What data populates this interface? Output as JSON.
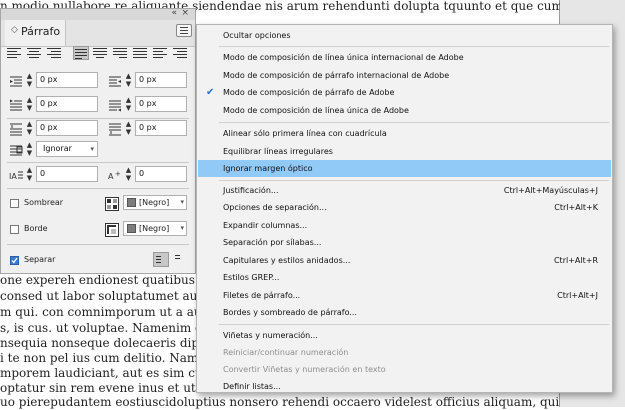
{
  "document": {
    "top_line": "n modio nullabore re aliquante siendendae nis arum rehendunti dolupta tquunto et que cum dolupta",
    "lines": [
      "one expereh endionest quatibus evende",
      "consed ut labor soluptatumet aut exerr",
      "m qui. con comnimporum ut a aut qui",
      "s, is cus. ut voluptae. Namenim olorit",
      "nsequia nonseque dolecaeris dipsam si",
      "i te non pel ius cum delitio. Nam, si ni b",
      "mporem laudiciant, aut es sim cum ever",
      "optatur sin rem evene inus et ut dolore,",
      "uo pierepudantem eostiuscidoluptius nonsero rehendi occaero videlest officius aliquam, qui nis non cus ni"
    ],
    "bottom_line": "uo pierepudantem eostiuscidoluptius nonsero rehendi occaero videlest officius aliquam, qui nis non cus ni"
  },
  "panel": {
    "collapse_label": "«",
    "close_label": "×",
    "tab_label": "Párrafo",
    "tab_arrows": "◇",
    "fields": {
      "left_indent": "0 px",
      "right_indent": "0 px",
      "first_line_indent": "0 px",
      "last_line_indent": "0 px",
      "space_before": "0 px",
      "space_after": "0 px",
      "align_grid": "Ignorar",
      "drop_cap_lines": "0",
      "drop_cap_chars": "0"
    },
    "shading_label": "Sombrear",
    "border_label": "Borde",
    "split_label": "Separar",
    "swatch_shading": "[Negro]",
    "swatch_border": "[Negro]"
  },
  "menu": {
    "items": [
      {
        "label": "Ocultar opciones",
        "shortcut": "",
        "state": "normal"
      },
      {
        "label": "Modo de composición de línea única internacional de Adobe",
        "shortcut": "",
        "state": "normal"
      },
      {
        "label": "Modo de composición de párrafo internacional de Adobe",
        "shortcut": "",
        "state": "normal"
      },
      {
        "label": "Modo de composición de párrafo de Adobe",
        "shortcut": "",
        "state": "checked"
      },
      {
        "label": "Modo de composición de línea única de Adobe",
        "shortcut": "",
        "state": "normal"
      },
      {
        "label": "Alinear sólo primera línea con cuadrícula",
        "shortcut": "",
        "state": "normal"
      },
      {
        "label": "Equilibrar líneas irregulares",
        "shortcut": "",
        "state": "normal"
      },
      {
        "label": "Ignorar margen óptico",
        "shortcut": "",
        "state": "highlight"
      },
      {
        "label": "Justificación...",
        "shortcut": "Ctrl+Alt+Mayúsculas+J",
        "state": "normal"
      },
      {
        "label": "Opciones de separación...",
        "shortcut": "Ctrl+Alt+K",
        "state": "normal"
      },
      {
        "label": "Expandir columnas...",
        "shortcut": "",
        "state": "normal"
      },
      {
        "label": "Separación por sílabas...",
        "shortcut": "",
        "state": "normal"
      },
      {
        "label": "Capitulares y estilos anidados...",
        "shortcut": "Ctrl+Alt+R",
        "state": "normal"
      },
      {
        "label": "Estilos GREP...",
        "shortcut": "",
        "state": "normal"
      },
      {
        "label": "Filetes de párrafo...",
        "shortcut": "Ctrl+Alt+J",
        "state": "normal"
      },
      {
        "label": "Bordes y sombreado de párrafo...",
        "shortcut": "",
        "state": "normal"
      },
      {
        "label": "Viñetas y numeración...",
        "shortcut": "",
        "state": "normal"
      },
      {
        "label": "Reiniciar/continuar numeración",
        "shortcut": "",
        "state": "disabled"
      },
      {
        "label": "Convertir Viñetas y numeración en texto",
        "shortcut": "",
        "state": "disabled"
      },
      {
        "label": "Definir listas...",
        "shortcut": "",
        "state": "normal"
      }
    ],
    "checkmark": "✔"
  },
  "colors": {
    "highlight": "#91c9f7",
    "menu_bg": "#f2f2f2",
    "panel_bg": "#f0f0f0"
  }
}
